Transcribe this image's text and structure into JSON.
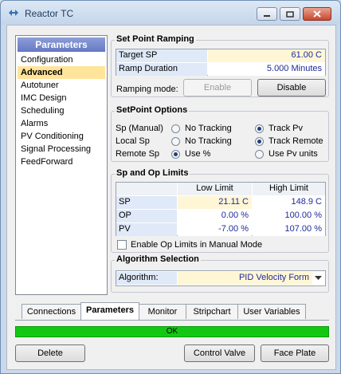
{
  "window": {
    "title": "Reactor TC",
    "icon": "tuning-icon"
  },
  "nav": {
    "header": "Parameters",
    "items": [
      "Configuration",
      "Advanced",
      "Autotuner",
      "IMC Design",
      "Scheduling",
      "Alarms",
      "PV Conditioning",
      "Signal Processing",
      "FeedForward"
    ],
    "selected": "Advanced"
  },
  "setpoint_ramping": {
    "title": "Set Point Ramping",
    "rows": [
      {
        "label": "Target SP",
        "value": "61.00 C"
      },
      {
        "label": "Ramp Duration",
        "value": "5.000 Minutes"
      }
    ],
    "ramping_mode_label": "Ramping mode:",
    "enable_label": "Enable",
    "disable_label": "Disable"
  },
  "setpoint_options": {
    "title": "SetPoint Options",
    "rows": [
      {
        "label": "Sp (Manual)",
        "opt1": "No Tracking",
        "opt2": "Track Pv",
        "selected": 2
      },
      {
        "label": "Local Sp",
        "opt1": "No Tracking",
        "opt2": "Track Remote",
        "selected": 2
      },
      {
        "label": "Remote Sp",
        "opt1": "Use %",
        "opt2": "Use Pv units",
        "selected": 1
      }
    ]
  },
  "limits": {
    "title": "Sp and Op Limits",
    "col_low": "Low Limit",
    "col_high": "High Limit",
    "rows": [
      {
        "label": "SP",
        "low": "21.11 C",
        "high": "148.9 C"
      },
      {
        "label": "OP",
        "low": "0.00 %",
        "high": "100.00 %"
      },
      {
        "label": "PV",
        "low": "-7.00 %",
        "high": "107.00 %"
      }
    ],
    "checkbox_label": "Enable Op Limits in Manual Mode",
    "checkbox_checked": false
  },
  "algorithm": {
    "title": "Algorithm Selection",
    "label": "Algorithm:",
    "value": "PID Velocity Form"
  },
  "tabs": [
    "Connections",
    "Parameters",
    "Monitor",
    "Stripchart",
    "User Variables"
  ],
  "active_tab": "Parameters",
  "status": {
    "text": "OK",
    "color": "#13c813"
  },
  "buttons": {
    "delete": "Delete",
    "control_valve": "Control Valve",
    "face_plate": "Face Plate"
  },
  "colors": {
    "accent_header": "#6678c4",
    "selected_item": "#ffe49a",
    "value_bg": "#fff6d5",
    "value_text": "#1f2a9a"
  }
}
